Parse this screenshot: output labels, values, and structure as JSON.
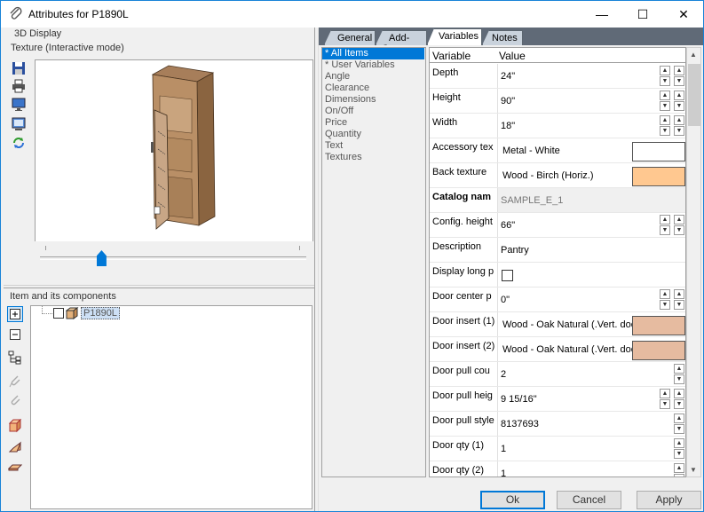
{
  "window": {
    "title": "Attributes for P1890L",
    "minimize": "—",
    "maximize": "☐",
    "close": "✕"
  },
  "left": {
    "display_label": "3D Display",
    "texture_label": "Texture (Interactive mode)",
    "slider_value_fraction": 0.22,
    "components_label": "Item and its components",
    "tree_item": "P1890L"
  },
  "tabs": [
    {
      "label": "General"
    },
    {
      "label": "Add-Ons"
    },
    {
      "label": "Variables"
    },
    {
      "label": "Notes"
    }
  ],
  "categories": [
    "* All Items",
    "* User Variables",
    "Angle",
    "Clearance",
    "Dimensions",
    "On/Off",
    "Price",
    "Quantity",
    "Text",
    "Textures"
  ],
  "grid": {
    "col_variable": "Variable",
    "col_value": "Value",
    "rows": [
      {
        "name": "Depth",
        "value": "24\""
      },
      {
        "name": "Height",
        "value": "90\""
      },
      {
        "name": "Width",
        "value": "18\""
      },
      {
        "name": "Accessory tex",
        "value": "Metal - White"
      },
      {
        "name": "Back texture",
        "value": "Wood - Birch (Horiz.)"
      },
      {
        "name": "Catalog nam",
        "value": "SAMPLE_E_1"
      },
      {
        "name": "Config. height",
        "value": "66\""
      },
      {
        "name": "Description",
        "value": "Pantry"
      },
      {
        "name": "Display long p",
        "value": ""
      },
      {
        "name": "Door center p",
        "value": "0\""
      },
      {
        "name": "Door insert (1)",
        "value": "Wood - Oak Natural (.Vert. doo"
      },
      {
        "name": "Door insert (2)",
        "value": "Wood - Oak Natural (.Vert. doo"
      },
      {
        "name": "Door pull cou",
        "value": "2"
      },
      {
        "name": "Door pull heig",
        "value": "9 15/16\""
      },
      {
        "name": "Door pull style",
        "value": "8137693"
      },
      {
        "name": "Door qty (1)",
        "value": "1"
      },
      {
        "name": "Door qty (2)",
        "value": "1"
      }
    ]
  },
  "colors": {
    "swatch_white": "#ffffff",
    "swatch_birch": "#ffc890",
    "swatch_oak": "#e6bba0"
  },
  "buttons": {
    "ok": "Ok",
    "cancel": "Cancel",
    "apply": "Apply"
  }
}
